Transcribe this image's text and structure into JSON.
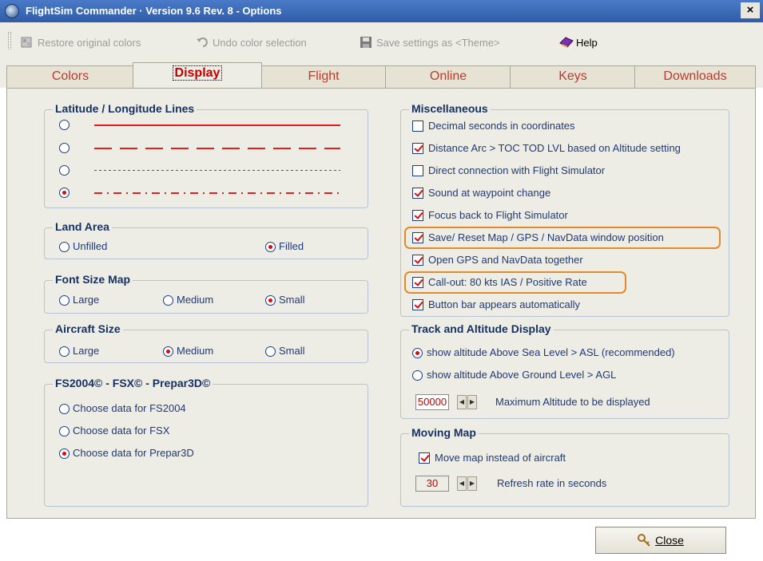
{
  "window": {
    "title": "FlightSim Commander · Version 9.6 Rev. 8 - Options",
    "close_glyph": "×"
  },
  "toolbar": {
    "restore_label": "Restore original colors",
    "undo_label": "Undo color selection",
    "save_label": "Save settings as <Theme>",
    "help_label": "Help"
  },
  "tabs": [
    "Colors",
    "Display",
    "Flight",
    "Online",
    "Keys",
    "Downloads"
  ],
  "selected_tab": "Display",
  "latlon": {
    "title": "Latitude / Longitude Lines",
    "options": [
      "solid",
      "long-dash",
      "dotted",
      "dash-dot"
    ],
    "selected": 3
  },
  "land_area": {
    "title": "Land Area",
    "options": [
      "Unfilled",
      "Filled"
    ],
    "selected": "Filled"
  },
  "font_size": {
    "title": "Font Size Map",
    "options": [
      "Large",
      "Medium",
      "Small"
    ],
    "selected": "Small"
  },
  "aircraft_size": {
    "title": "Aircraft Size",
    "options": [
      "Large",
      "Medium",
      "Small"
    ],
    "selected": "Medium"
  },
  "fs": {
    "title": "FS2004© - FSX© - Prepar3D©",
    "options": [
      "Choose data for FS2004",
      "Choose data for FSX",
      "Choose data for Prepar3D"
    ],
    "selected": "Choose data for Prepar3D"
  },
  "misc": {
    "title": "Miscellaneous",
    "items": [
      {
        "label": "Decimal seconds in coordinates",
        "checked": false
      },
      {
        "label": "Distance Arc > TOC TOD LVL based on Altitude setting",
        "checked": true
      },
      {
        "label": "Direct connection with Flight Simulator",
        "checked": false
      },
      {
        "label": "Sound at waypoint change",
        "checked": true
      },
      {
        "label": "Focus back to Flight Simulator",
        "checked": true
      },
      {
        "label": "Save/ Reset Map / GPS / NavData window position",
        "checked": true
      },
      {
        "label": "Open GPS and NavData together",
        "checked": true
      },
      {
        "label": "Call-out: 80 kts IAS / Positive Rate",
        "checked": true
      },
      {
        "label": "Button bar appears automatically",
        "checked": true
      }
    ]
  },
  "track": {
    "title": "Track and Altitude Display",
    "asl_label": "show altitude Above Sea Level > ASL (recommended)",
    "agl_label": "show altitude Above Ground Level > AGL",
    "selected": "ASL",
    "max_alt_value": "50000",
    "max_alt_label": "Maximum Altitude to be displayed"
  },
  "moving_map": {
    "title": "Moving Map",
    "move_label": "Move map instead of aircraft",
    "move_checked": true,
    "refresh_value": "30",
    "refresh_label": "Refresh rate in seconds"
  },
  "footer": {
    "close_label": "Close"
  },
  "colors": {
    "accent_red": "#c00000",
    "line_red": "#e02020",
    "label_blue": "#1f3a7a",
    "highlight_orange": "#e08a2a"
  }
}
